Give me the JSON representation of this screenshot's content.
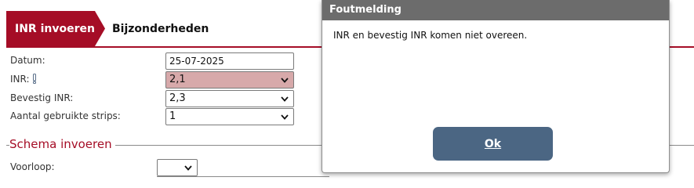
{
  "tabs": {
    "active": "INR invoeren",
    "inactive": "Bijzonderheden"
  },
  "form": {
    "datum": {
      "label": "Datum:",
      "value": "25-07-2025"
    },
    "inr": {
      "label": "INR:",
      "value": "2,1"
    },
    "bevestig": {
      "label": "Bevestig INR:",
      "value": "2,3"
    },
    "strips": {
      "label": "Aantal gebruikte strips:",
      "value": "1"
    }
  },
  "schema": {
    "legend": "Schema invoeren",
    "voorloop_label": "Voorloop:",
    "voorloop_value": ""
  },
  "dialog": {
    "title": "Foutmelding",
    "message": "INR en bevestig INR komen niet overeen.",
    "ok_label": "Ok"
  },
  "colors": {
    "brand": "#a50d26",
    "error_field": "#d7a9aa",
    "button": "#4b6683",
    "dialog_header": "#6c6c6c"
  },
  "icons": {
    "inr_warning": "exclamation-warning-icon",
    "select_arrow": "chevron-down-icon"
  }
}
